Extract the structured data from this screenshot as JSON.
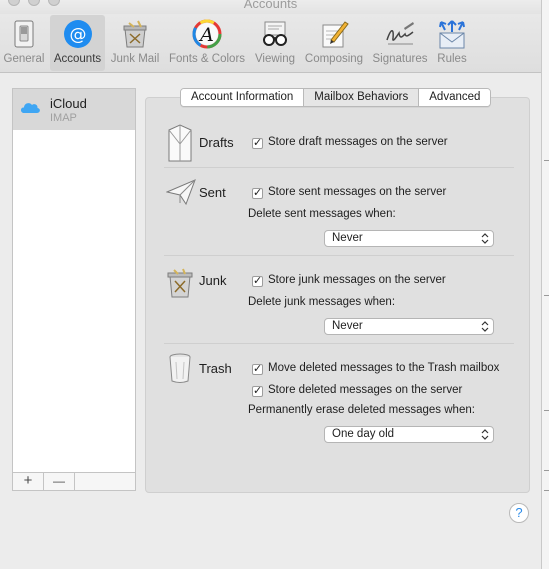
{
  "window": {
    "title": "Accounts"
  },
  "toolbar": {
    "items": [
      {
        "label": "General",
        "icon": "switch-icon"
      },
      {
        "label": "Accounts",
        "icon": "at-sign-icon",
        "selected": true
      },
      {
        "label": "Junk Mail",
        "icon": "junk-bin-icon"
      },
      {
        "label": "Fonts & Colors",
        "icon": "font-palette-icon"
      },
      {
        "label": "Viewing",
        "icon": "glasses-icon"
      },
      {
        "label": "Composing",
        "icon": "pencil-paper-icon"
      },
      {
        "label": "Signatures",
        "icon": "signature-icon"
      },
      {
        "label": "Rules",
        "icon": "rules-envelope-icon"
      }
    ]
  },
  "accounts": {
    "items": [
      {
        "name": "iCloud",
        "type": "IMAP",
        "icon": "icloud-icon"
      }
    ],
    "add_label": "+",
    "remove_label": "—"
  },
  "tabs": [
    {
      "label": "Account Information"
    },
    {
      "label": "Mailbox Behaviors",
      "active": true
    },
    {
      "label": "Advanced"
    }
  ],
  "sections": {
    "drafts": {
      "label": "Drafts",
      "checkbox": {
        "label": "Store draft messages on the server",
        "checked": true
      }
    },
    "sent": {
      "label": "Sent",
      "checkbox": {
        "label": "Store sent messages on the server",
        "checked": true
      },
      "delete_label": "Delete sent messages when:",
      "delete_value": "Never"
    },
    "junk": {
      "label": "Junk",
      "checkbox": {
        "label": "Store junk messages on the server",
        "checked": true
      },
      "delete_label": "Delete junk messages when:",
      "delete_value": "Never"
    },
    "trash": {
      "label": "Trash",
      "checkbox1": {
        "label": "Move deleted messages to the Trash mailbox",
        "checked": true
      },
      "checkbox2": {
        "label": "Store deleted messages on the server",
        "checked": true
      },
      "erase_label": "Permanently erase deleted messages when:",
      "erase_value": "One day old"
    }
  },
  "help": {
    "label": "?"
  },
  "colors": {
    "accent": "#1f8cf0",
    "panel": "#e0e0e0",
    "selection": "#d8d8d8"
  }
}
